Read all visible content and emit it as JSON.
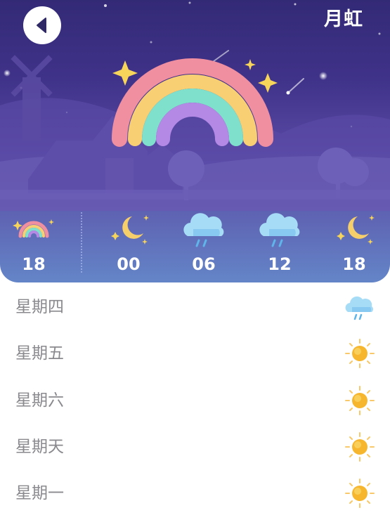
{
  "header": {
    "title": "月虹",
    "back_icon": "chevron-left-icon",
    "main_icon": "rainbow-icon"
  },
  "hourly": [
    {
      "time": "18",
      "icon": "rainbow-icon"
    },
    {
      "time": "00",
      "icon": "moon-icon"
    },
    {
      "time": "06",
      "icon": "rain-cloud-icon"
    },
    {
      "time": "12",
      "icon": "rain-cloud-icon"
    },
    {
      "time": "18",
      "icon": "moon-icon"
    }
  ],
  "daily": [
    {
      "day": "星期四",
      "icon": "rain-cloud-icon"
    },
    {
      "day": "星期五",
      "icon": "sun-icon"
    },
    {
      "day": "星期六",
      "icon": "sun-icon"
    },
    {
      "day": "星期天",
      "icon": "sun-icon"
    },
    {
      "day": "星期一",
      "icon": "sun-icon"
    }
  ],
  "colors": {
    "sky_top": "#332a76",
    "sky_bottom": "#6485c8",
    "day_text": "#8a8a8e",
    "sun": "#f6b72f",
    "rain_cloud": "#8fd0f5"
  }
}
